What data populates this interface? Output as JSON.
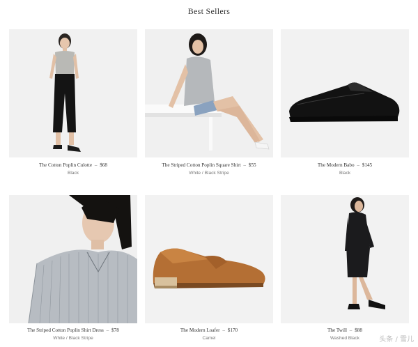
{
  "page": {
    "title": "Best Sellers"
  },
  "products": [
    {
      "name": "The Cotton Poplin Culotte",
      "price": "$68",
      "color": "Black",
      "image_icon": "model-culotte-image"
    },
    {
      "name": "The Striped Cotton Poplin Square Shirt",
      "price": "$55",
      "color": "White / Black Stripe",
      "image_icon": "model-square-shirt-image"
    },
    {
      "name": "The Modern Babo",
      "price": "$145",
      "color": "Black",
      "image_icon": "black-slide-shoe-image"
    },
    {
      "name": "The Striped Cotton Poplin Shirt Dress",
      "price": "$78",
      "color": "White / Black Stripe",
      "image_icon": "model-shirt-dress-image"
    },
    {
      "name": "The Modern Loafer",
      "price": "$170",
      "color": "Camel",
      "image_icon": "camel-loafer-image"
    },
    {
      "name": "The Twill",
      "price": "$88",
      "color": "Washed Black",
      "image_icon": "model-twill-dress-image"
    }
  ],
  "price_separator": "–",
  "watermark": {
    "text": "头条 / 雪儿"
  }
}
